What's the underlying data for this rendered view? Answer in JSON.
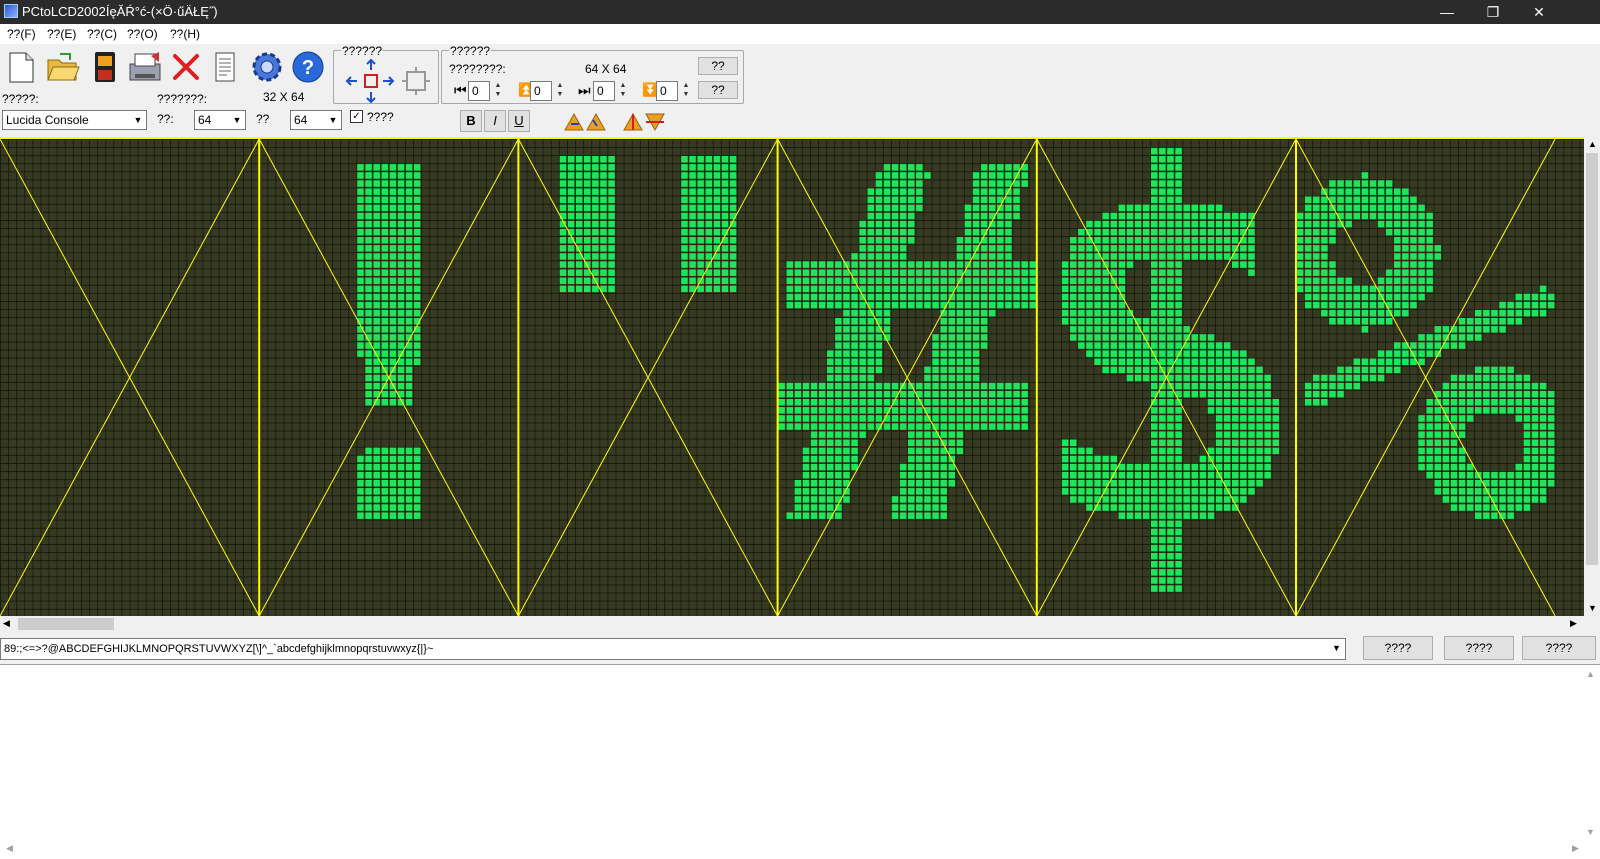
{
  "window": {
    "title": "PCtoLCD2002ÍęĂŔ°ć-(×Ö·űÄŁĘ˝)",
    "minimize": "—",
    "restore": "❐",
    "close": "✕"
  },
  "menu": [
    "??(F)",
    "??(E)",
    "??(C)",
    "??(O)",
    "??(H)"
  ],
  "toolbar": {
    "font_label": "?????:",
    "font_value": "Lucida Console",
    "width_label_top": "???????:",
    "size_display": "32 X 64",
    "width_label": "??:",
    "width_value": "64",
    "height_label": "??",
    "height_value": "64",
    "checkbox_label": "????",
    "checkbox_mark": "✓",
    "arrow_group_title": "??????",
    "offset_group_title": "??????",
    "offset_label": "????????:",
    "offset_size": "64 X 64",
    "spin_values": [
      "0",
      "0",
      "0",
      "0"
    ],
    "btn1": "??",
    "btn2": "??",
    "bold": "B",
    "italic": "I",
    "underline": "U"
  },
  "lcd": {
    "chars": [
      " ",
      "!",
      "\"",
      "#",
      "$",
      "%"
    ],
    "pixel_color": "#1ee65a",
    "bg_color": "#363a22",
    "grid_color": "#161808",
    "guide_color": "#ffff00"
  },
  "input_text": "89:;<=>?@ABCDEFGHIJKLMNOPQRSTUVWXYZ[\\]^_`abcdefghijklmnopqrstuvwxyz{|}~",
  "buttons": [
    "????",
    "????",
    "????"
  ]
}
